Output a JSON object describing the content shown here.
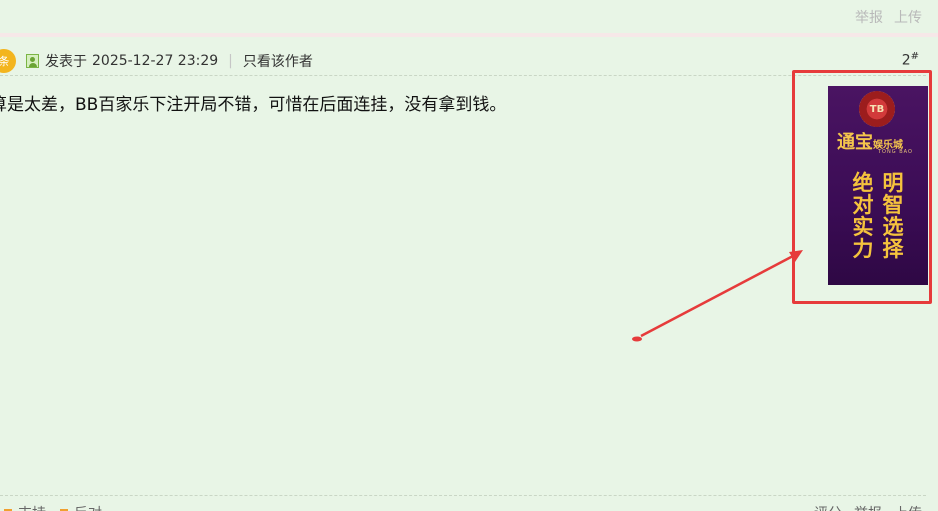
{
  "top_actions": {
    "report": "举报",
    "upload": "上传"
  },
  "post": {
    "badge": "条",
    "posted_label": "发表于",
    "datetime": "2025-12-27 23:29",
    "separator": "|",
    "only_author": "只看该作者",
    "floor": "2",
    "floor_mark": "#",
    "content": "算是太差，BB百家乐下注开局不错，可惜在后面连挂，没有拿到钱。"
  },
  "ad": {
    "chip_text": "TB",
    "brand": "通宝",
    "brand_suffix": "娱乐城",
    "brand_en": "TONG BAO",
    "slogan_left": [
      "绝",
      "对",
      "实",
      "力"
    ],
    "slogan_right": [
      "明",
      "智",
      "选",
      "择"
    ]
  },
  "footer": {
    "left_items": [
      "支持",
      "反对"
    ],
    "right_items": [
      "评分",
      "举报",
      "上传"
    ]
  },
  "colors": {
    "background": "#e8f5e6",
    "annotation": "#e63b3b",
    "ad_gold": "#f5c33d",
    "ad_purple": "#4a1462"
  }
}
